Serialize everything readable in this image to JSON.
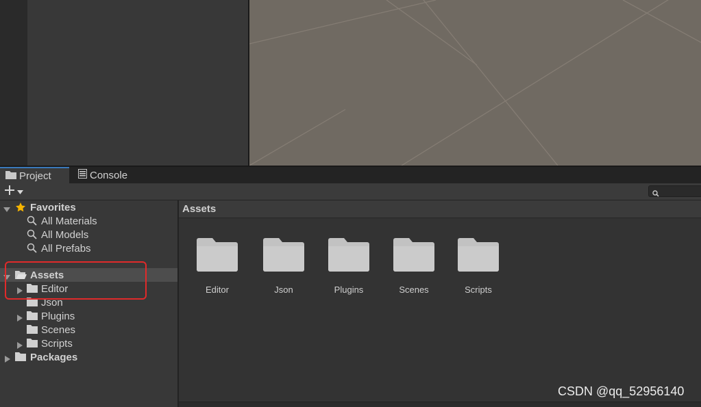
{
  "tabs": [
    {
      "label": "Project",
      "icon": "folder-icon",
      "active": true
    },
    {
      "label": "Console",
      "icon": "console-icon",
      "active": false
    }
  ],
  "toolbar": {
    "add_label": "+",
    "search_placeholder": ""
  },
  "tree": {
    "favorites": {
      "label": "Favorites",
      "items": [
        "All Materials",
        "All Models",
        "All Prefabs"
      ]
    },
    "assets": {
      "label": "Assets",
      "children": [
        "Editor",
        "Json",
        "Plugins",
        "Scenes",
        "Scripts"
      ]
    },
    "packages": {
      "label": "Packages"
    }
  },
  "assets_view": {
    "header": "Assets",
    "items": [
      "Editor",
      "Json",
      "Plugins",
      "Scenes",
      "Scripts"
    ]
  },
  "watermark": "CSDN @qq_52956140",
  "colors": {
    "accent_tab": "#3a79bb",
    "highlight": "#e12a2a",
    "star": "#f5b400",
    "folder": "#c2c2c2"
  }
}
